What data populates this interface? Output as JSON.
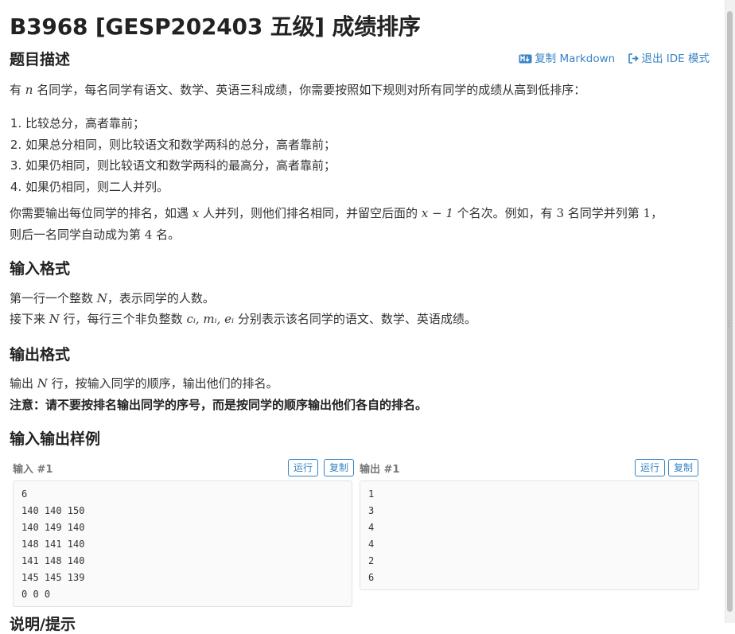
{
  "title": "B3968 [GESP202403 五级] 成绩排序",
  "toplinks": {
    "copy_markdown": "复制 Markdown",
    "exit_ide": "退出 IDE 模式"
  },
  "sections": {
    "description": "题目描述",
    "input_format": "输入格式",
    "output_format": "输出格式",
    "samples": "输入输出样例",
    "hint": "说明/提示"
  },
  "desc": {
    "p1_a": "有 ",
    "p1_n": "n",
    "p1_b": " 名同学，每名同学有语文、数学、英语三科成绩，你需要按照如下规则对所有同学的成绩从高到低排序：",
    "rules": [
      "比较总分，高者靠前；",
      "如果总分相同，则比较语文和数学两科的总分，高者靠前；",
      "如果仍相同，则比较语文和数学两科的最高分，高者靠前；",
      "如果仍相同，则二人并列。"
    ],
    "p2_a": "你需要输出每位同学的排名，如遇 ",
    "p2_x": "x",
    "p2_b": " 人并列，则他们排名相同，并留空后面的 ",
    "p2_expr": "x − 1",
    "p2_c": " 个名次。例如，有 ",
    "p2_three": "3",
    "p2_d": " 名同学并列第 ",
    "p2_one": "1",
    "p2_e": "，",
    "p3_a": "则后一名同学自动成为第 ",
    "p3_four": "4",
    "p3_b": " 名。"
  },
  "input_format": {
    "l1_a": "第一行一个整数 ",
    "l1_N": "N",
    "l1_b": "，表示同学的人数。",
    "l2_a": "接下来 ",
    "l2_N": "N",
    "l2_b": " 行，每行三个非负整数 ",
    "l2_vars": "cᵢ, mᵢ, eᵢ",
    "l2_c": " 分别表示该名同学的语文、数学、英语成绩。"
  },
  "output_format": {
    "l1_a": "输出 ",
    "l1_N": "N",
    "l1_b": " 行，按输入同学的顺序，输出他们的排名。",
    "note": "注意：请不要按排名输出同学的序号，而是按同学的顺序输出他们各自的排名。"
  },
  "samples": {
    "input_label": "输入 #1",
    "output_label": "输出 #1",
    "run_label": "运行",
    "copy_label": "复制",
    "input_text": "6\n140 140 150\n140 149 140\n148 141 140\n141 148 140\n145 145 139\n0 0 0",
    "output_text": "1\n3\n4\n4\n2\n6"
  },
  "colors": {
    "link": "#3a84c4",
    "heading": "#222222",
    "text": "#333333"
  }
}
